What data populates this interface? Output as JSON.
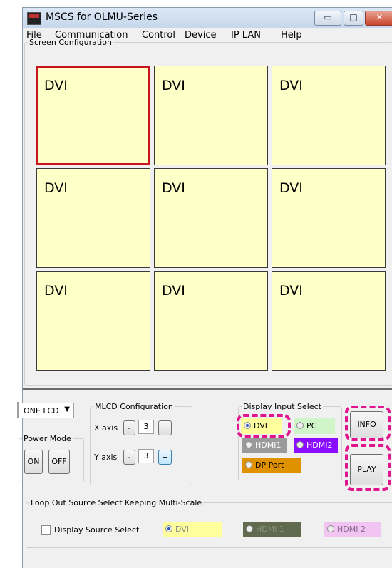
{
  "window": {
    "title": "MSCS for OLMU-Series"
  },
  "menu": [
    "File",
    "Communication",
    "Control",
    "Device",
    "IP LAN",
    "Help"
  ],
  "screen_config": {
    "legend": "Screen Configuration",
    "cells": [
      "DVI",
      "DVI",
      "DVI",
      "DVI",
      "DVI",
      "DVI",
      "DVI",
      "DVI",
      "DVI"
    ]
  },
  "lcd_select": {
    "value": "ONE LCD"
  },
  "power": {
    "legend": "Power Mode",
    "on": "ON",
    "off": "OFF"
  },
  "mlcd": {
    "legend": "MLCD Configuration",
    "x_label": "X axis",
    "x_value": "3",
    "y_label": "Y axis",
    "y_value": "3",
    "minus": "-",
    "plus": "+"
  },
  "display_input": {
    "legend": "Display Input Select",
    "dvi": "DVI",
    "pc": "PC",
    "hdmi1": "HDMI1",
    "hdmi2": "HDMI2",
    "dp": "DP Port",
    "selected": "DVI"
  },
  "buttons": {
    "info": "INFO",
    "play": "PLAY"
  },
  "loop_out": {
    "legend": "Loop Out Source Select Keeping Multi-Scale",
    "checkbox_label": "Display Source Select",
    "dvi": "DVI",
    "hdmi1": "HDMI 1",
    "hdmi2": "HDMI 2"
  },
  "colors": {
    "cell_bg": "#ffffc8",
    "selected_border": "#c8141e",
    "highlight_dash": "#e0148c",
    "pc_bg": "#d0f5c8",
    "hdmi1_bg": "#9a9a9a",
    "hdmi2_bg": "#8a0dff",
    "dp_bg": "#e09100",
    "loop_dvi_bg": "#ffff9e",
    "loop_hdmi1_bg": "#5f6a4e",
    "loop_hdmi2_bg": "#f2c4f2"
  }
}
